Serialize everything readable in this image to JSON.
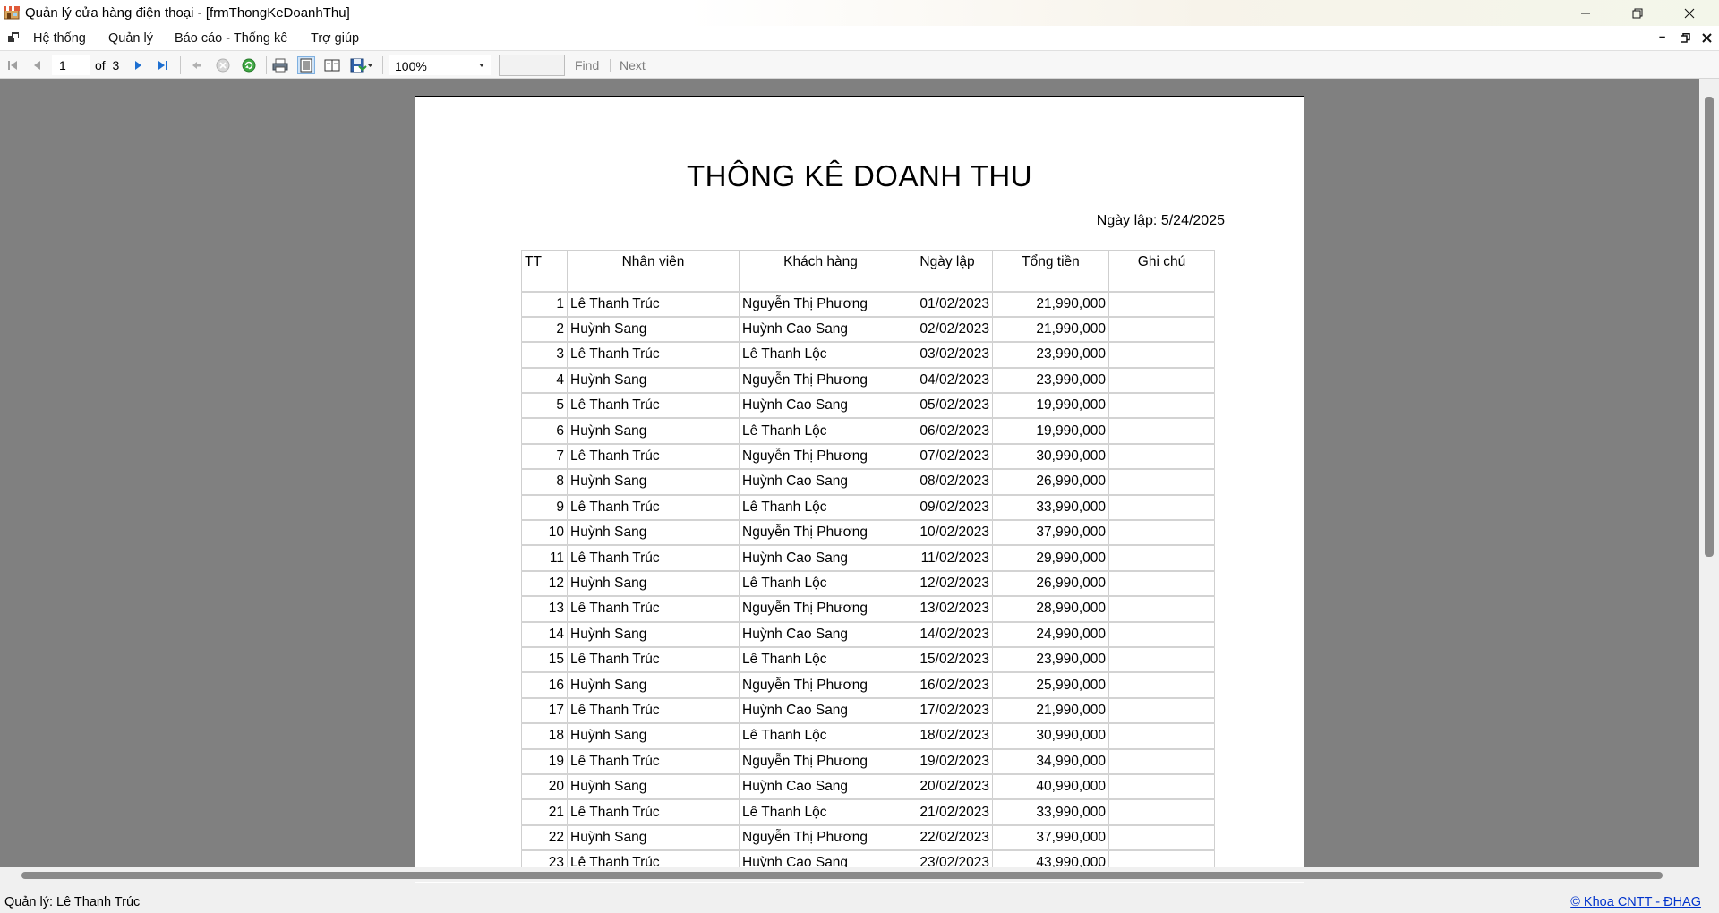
{
  "window": {
    "title": "Quản lý cửa hàng điện thoại - [frmThongKeDoanhThu]",
    "minimize_icon": "minimize-icon",
    "restore_icon": "restore-icon",
    "close_icon": "close-icon"
  },
  "menubar": {
    "items": [
      "Hệ thống",
      "Quản lý",
      "Báo cáo - Thống kê",
      "Trợ giúp"
    ]
  },
  "toolbar": {
    "current_page": "1",
    "of_label": "of",
    "total_pages": "3",
    "zoom": "100%",
    "find_label": "Find",
    "next_label": "Next",
    "accent_color": "#1d6fd1"
  },
  "report": {
    "title": "THÔNG KÊ DOANH THU",
    "date_label": "Ngày lập: 5/24/2025",
    "columns": [
      "TT",
      "Nhân viên",
      "Khách hàng",
      "Ngày lập",
      "Tổng tiền",
      "Ghi chú"
    ],
    "rows": [
      [
        "1",
        "Lê Thanh Trúc",
        "Nguyễn Thị Phương",
        "01/02/2023",
        "21,990,000",
        ""
      ],
      [
        "2",
        "Huỳnh Sang",
        "Huỳnh Cao Sang",
        "02/02/2023",
        "21,990,000",
        ""
      ],
      [
        "3",
        "Lê Thanh Trúc",
        "Lê Thanh Lộc",
        "03/02/2023",
        "23,990,000",
        ""
      ],
      [
        "4",
        "Huỳnh Sang",
        "Nguyễn Thị Phương",
        "04/02/2023",
        "23,990,000",
        ""
      ],
      [
        "5",
        "Lê Thanh Trúc",
        "Huỳnh Cao Sang",
        "05/02/2023",
        "19,990,000",
        ""
      ],
      [
        "6",
        "Huỳnh Sang",
        "Lê Thanh Lộc",
        "06/02/2023",
        "19,990,000",
        ""
      ],
      [
        "7",
        "Lê Thanh Trúc",
        "Nguyễn Thị Phương",
        "07/02/2023",
        "30,990,000",
        ""
      ],
      [
        "8",
        "Huỳnh Sang",
        "Huỳnh Cao Sang",
        "08/02/2023",
        "26,990,000",
        ""
      ],
      [
        "9",
        "Lê Thanh Trúc",
        "Lê Thanh Lộc",
        "09/02/2023",
        "33,990,000",
        ""
      ],
      [
        "10",
        "Huỳnh Sang",
        "Nguyễn Thị Phương",
        "10/02/2023",
        "37,990,000",
        ""
      ],
      [
        "11",
        "Lê Thanh Trúc",
        "Huỳnh Cao Sang",
        "11/02/2023",
        "29,990,000",
        ""
      ],
      [
        "12",
        "Huỳnh Sang",
        "Lê Thanh Lộc",
        "12/02/2023",
        "26,990,000",
        ""
      ],
      [
        "13",
        "Lê Thanh Trúc",
        "Nguyễn Thị Phương",
        "13/02/2023",
        "28,990,000",
        ""
      ],
      [
        "14",
        "Huỳnh Sang",
        "Huỳnh Cao Sang",
        "14/02/2023",
        "24,990,000",
        ""
      ],
      [
        "15",
        "Lê Thanh Trúc",
        "Lê Thanh Lộc",
        "15/02/2023",
        "23,990,000",
        ""
      ],
      [
        "16",
        "Huỳnh Sang",
        "Nguyễn Thị Phương",
        "16/02/2023",
        "25,990,000",
        ""
      ],
      [
        "17",
        "Lê Thanh Trúc",
        "Huỳnh Cao Sang",
        "17/02/2023",
        "21,990,000",
        ""
      ],
      [
        "18",
        "Huỳnh Sang",
        "Lê Thanh Lộc",
        "18/02/2023",
        "30,990,000",
        ""
      ],
      [
        "19",
        "Lê Thanh Trúc",
        "Nguyễn Thị Phương",
        "19/02/2023",
        "34,990,000",
        ""
      ],
      [
        "20",
        "Huỳnh Sang",
        "Huỳnh Cao Sang",
        "20/02/2023",
        "40,990,000",
        ""
      ],
      [
        "21",
        "Lê Thanh Trúc",
        "Lê Thanh Lộc",
        "21/02/2023",
        "33,990,000",
        ""
      ],
      [
        "22",
        "Huỳnh Sang",
        "Nguyễn Thị Phương",
        "22/02/2023",
        "37,990,000",
        ""
      ],
      [
        "23",
        "Lê Thanh Trúc",
        "Huỳnh Cao Sang",
        "23/02/2023",
        "43,990,000",
        ""
      ]
    ]
  },
  "statusbar": {
    "user_label": "Quản lý: Lê Thanh Trúc",
    "credit_link": "© Khoa CNTT - ĐHAG"
  }
}
